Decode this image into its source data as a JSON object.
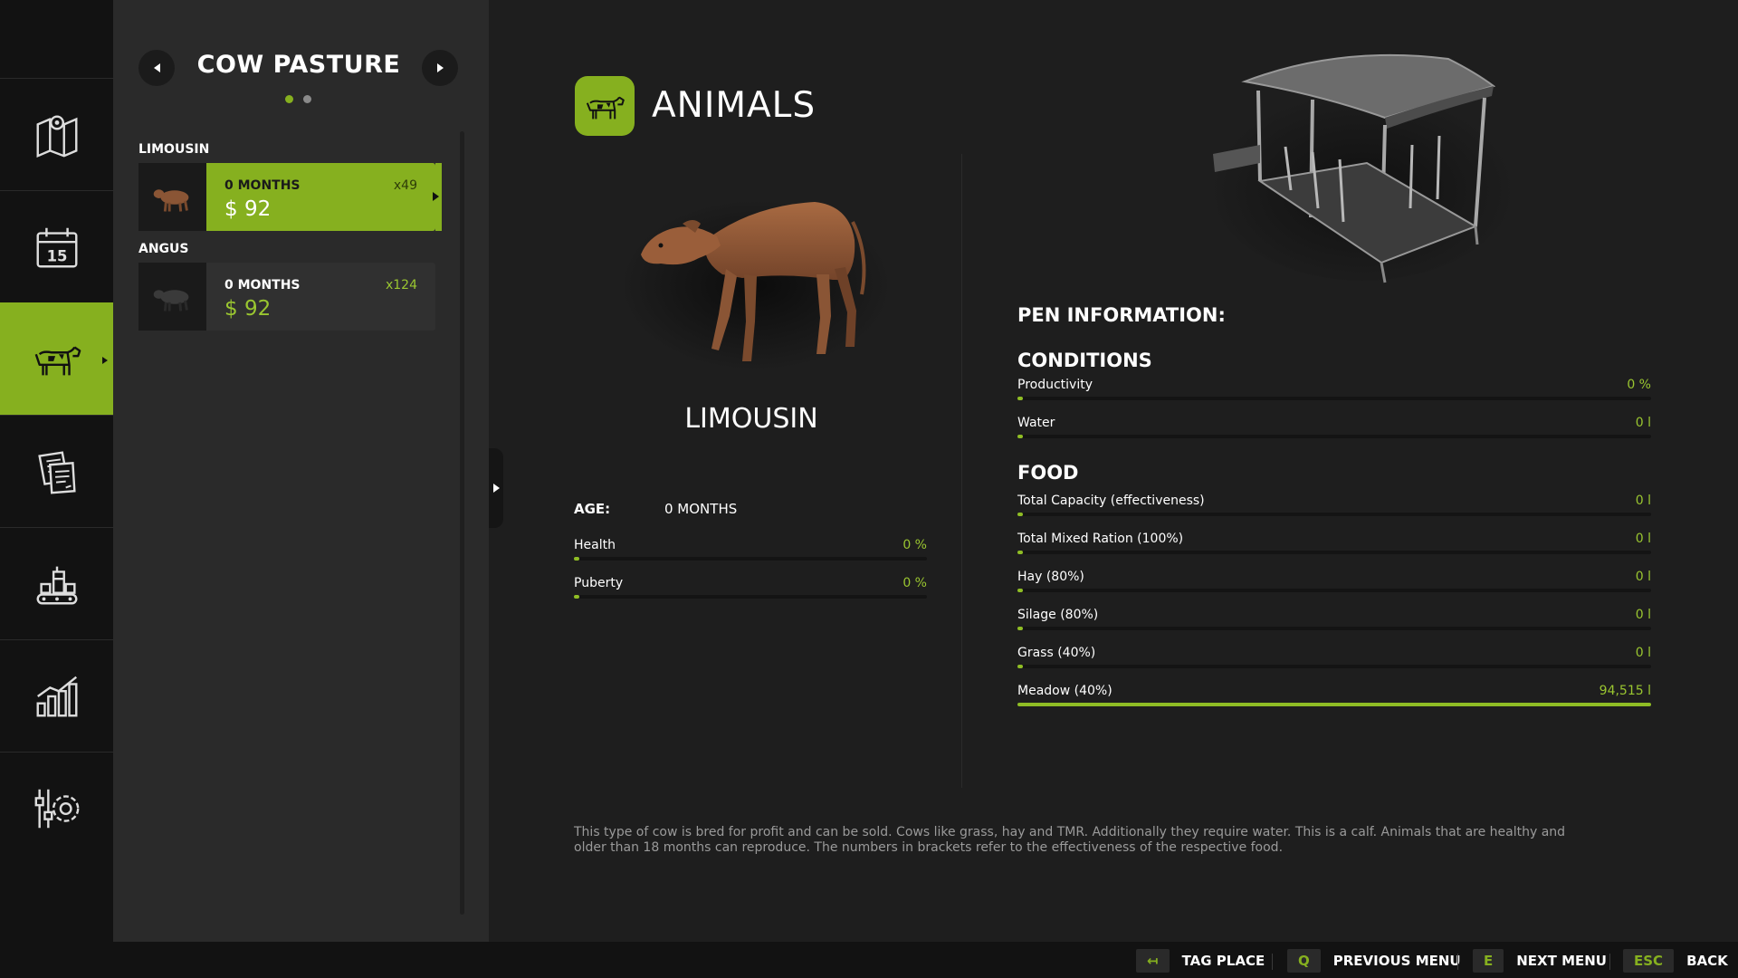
{
  "sidebar": {
    "items": [
      {
        "icon": "map-icon"
      },
      {
        "icon": "calendar-icon",
        "day": "15"
      },
      {
        "icon": "cow-icon",
        "active": true
      },
      {
        "icon": "contracts-icon"
      },
      {
        "icon": "production-icon"
      },
      {
        "icon": "statistics-icon"
      },
      {
        "icon": "settings-icon"
      }
    ]
  },
  "list": {
    "title": "COW PASTURE",
    "page_dots": 2,
    "groups": [
      {
        "breed": "LIMOUSIN",
        "age": "0 MONTHS",
        "count": "x49",
        "price": "$ 92",
        "selected": true
      },
      {
        "breed": "ANGUS",
        "age": "0 MONTHS",
        "count": "x124",
        "price": "$ 92",
        "selected": false
      }
    ]
  },
  "main": {
    "title": "ANIMALS",
    "animal_name": "LIMOUSIN",
    "age_label": "AGE:",
    "age_value": "0 MONTHS",
    "stats": [
      {
        "label": "Health",
        "value": "0 %",
        "fraction": 0
      },
      {
        "label": "Puberty",
        "value": "0 %",
        "fraction": 0
      }
    ],
    "description": "This type of cow is bred for profit and can be sold. Cows like grass, hay and TMR. Additionally they require water. This is a calf. Animals that are healthy and older than 18 months can reproduce. The numbers in brackets refer to the effectiveness of the respective food."
  },
  "pen": {
    "heading": "PEN INFORMATION:",
    "conditions_heading": "CONDITIONS",
    "conditions": [
      {
        "label": "Productivity",
        "value": "0 %",
        "fraction": 0
      },
      {
        "label": "Water",
        "value": "0 l",
        "fraction": 0
      }
    ],
    "food_heading": "FOOD",
    "food": [
      {
        "label": "Total Capacity (effectiveness)",
        "value": "0 l",
        "fraction": 0
      },
      {
        "label": "Total Mixed Ration (100%)",
        "value": "0 l",
        "fraction": 0
      },
      {
        "label": "Hay (80%)",
        "value": "0 l",
        "fraction": 0
      },
      {
        "label": "Silage (80%)",
        "value": "0 l",
        "fraction": 0
      },
      {
        "label": "Grass (40%)",
        "value": "0 l",
        "fraction": 0
      },
      {
        "label": "Meadow (40%)",
        "value": "94,515 l",
        "fraction": 1
      }
    ]
  },
  "bottom_bar": {
    "hints": [
      {
        "key": "↤",
        "label": "TAG PLACE"
      },
      {
        "key": "Q",
        "label": "PREVIOUS MENU"
      },
      {
        "key": "E",
        "label": "NEXT MENU"
      },
      {
        "key": "ESC",
        "label": "BACK"
      }
    ]
  },
  "colors": {
    "accent": "#86b01f",
    "value_text": "#9ac630",
    "rail_bg": "#121212",
    "panel_bg": "#2a2a2a",
    "main_bg": "#1e1e1e"
  }
}
